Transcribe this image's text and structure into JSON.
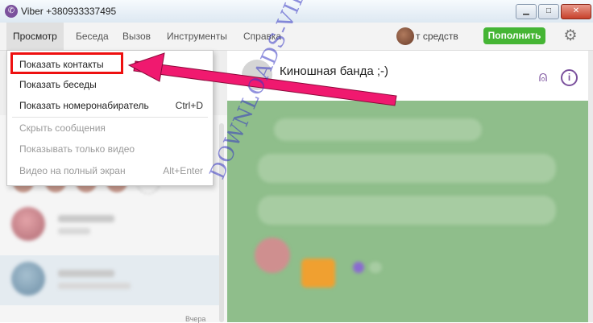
{
  "window": {
    "title": "Viber +380933337495",
    "app_icon": "viber-icon",
    "controls": [
      "minimize-icon",
      "maximize-icon",
      "close-icon"
    ]
  },
  "menubar": {
    "items": [
      {
        "label": "Просмотр",
        "active": true
      },
      {
        "label": "Беседа"
      },
      {
        "label": "Вызов"
      },
      {
        "label": "Инструменты"
      },
      {
        "label": "Справка"
      }
    ],
    "balance_text": "т средств",
    "topup_label": "Пополнить",
    "settings_icon": "gear-icon"
  },
  "dropdown": {
    "items": [
      {
        "label": "Показать контакты",
        "shortcut": "",
        "disabled": false
      },
      {
        "label": "Показать беседы",
        "shortcut": "",
        "disabled": false
      },
      {
        "label": "Показать номеронабиратель",
        "shortcut": "Ctrl+D",
        "disabled": false
      },
      {
        "label": "Скрыть сообщения",
        "shortcut": "",
        "disabled": true
      },
      {
        "label": "Показывать только видео",
        "shortcut": "",
        "disabled": true
      },
      {
        "label": "Видео на полный экран",
        "shortcut": "Alt+Enter",
        "disabled": true
      }
    ]
  },
  "chat": {
    "title": "Киношная банда ;-)"
  },
  "sidebar": {
    "last_time": "Вчера"
  },
  "watermark": "DOWNLOADS-VIBER.COM",
  "colors": {
    "accent": "#7b519d",
    "topup": "#45b534",
    "highlight": "#ee1010",
    "arrow": "#f0196f",
    "chat_bg": "#8fbe8b"
  }
}
